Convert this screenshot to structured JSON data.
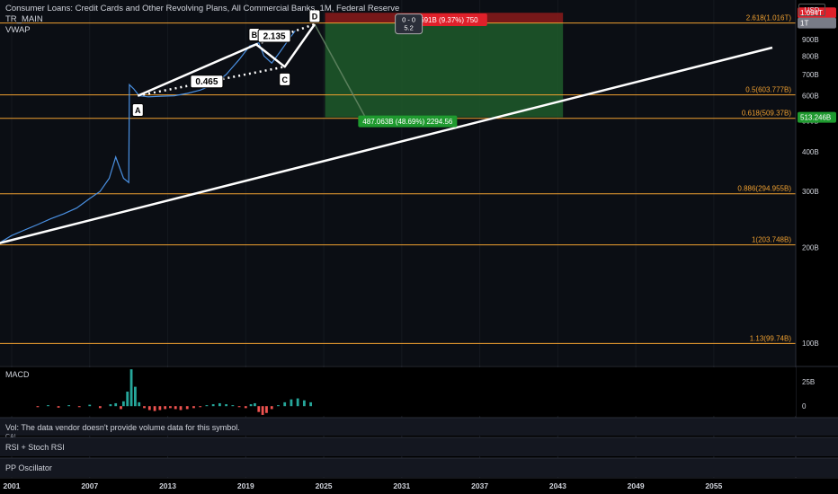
{
  "header": {
    "title": "Consumer Loans: Credit Cards and Other Revolving Plans, All Commercial Banks, 1M, Federal Reserve",
    "indicators": [
      "TR_MAIN",
      "VWAP"
    ]
  },
  "currency_button": "USD",
  "colors": {
    "background": "#000000",
    "price_line": "#4a90e2",
    "fib_line": "#f0a030",
    "pattern_line": "#ffffff",
    "stop_zone": "#8b1a1a",
    "target_zone": "#1e5a2a",
    "badge_red": "#e0202a",
    "badge_green": "#1f9a2f",
    "macd_pos": "#26a69a",
    "macd_neg": "#ef5350"
  },
  "chart_data": {
    "type": "line",
    "title": "Consumer Loans: Credit Cards and Other Revolving Plans, All Commercial Banks, 1M, Federal Reserve",
    "x_ticks": [
      "2001",
      "2007",
      "2013",
      "2019",
      "2025",
      "2031",
      "2037",
      "2043",
      "2049",
      "2055"
    ],
    "x_range": [
      2000.1,
      2061.3
    ],
    "y_scale": "log",
    "y_range_billions": [
      85,
      1200
    ],
    "y_ticks": [
      "1T",
      "900B",
      "800B",
      "700B",
      "600B",
      "500B",
      "400B",
      "300B",
      "200B",
      "100B"
    ],
    "y_tick_values": [
      1000,
      900,
      800,
      700,
      600,
      500,
      400,
      300,
      200,
      100
    ],
    "series": [
      {
        "name": "",
        "x": [
          2000.0,
          2001.0,
          2002.0,
          2003.0,
          2004.0,
          2005.0,
          2006.0,
          2007.0,
          2007.8,
          2008.5,
          2009.0,
          2009.6,
          2010.0,
          2010.05,
          2010.4,
          2010.8,
          2011.5,
          2012.5,
          2013.5,
          2014.5,
          2015.5,
          2016.5,
          2017.5,
          2018.5,
          2019.3,
          2020.0,
          2020.4,
          2021.0,
          2021.6,
          2022.3,
          2022.8
        ],
        "y": [
          206,
          218,
          227,
          236,
          246,
          255,
          266,
          285,
          300,
          330,
          385,
          330,
          320,
          650,
          630,
          600,
          595,
          598,
          600,
          610,
          625,
          650,
          700,
          780,
          860,
          880,
          800,
          760,
          820,
          900,
          960
        ]
      }
    ],
    "fib_levels": [
      {
        "label": "2.618(1.016T)",
        "value": 1016
      },
      {
        "label": "0.5(603.777B)",
        "value": 603.777
      },
      {
        "label": "0.618(509.37B)",
        "value": 509.37
      },
      {
        "label": "0.886(294.955B)",
        "value": 294.955
      },
      {
        "label": "1(203.748B)",
        "value": 203.748
      },
      {
        "label": "1.13(99.74B)",
        "value": 99.74
      }
    ],
    "harmonic_pattern": {
      "points": [
        {
          "label": "A",
          "x": 2010.7,
          "y": 600
        },
        {
          "label": "B",
          "x": 2019.8,
          "y": 870
        },
        {
          "label": "C",
          "x": 2022.0,
          "y": 740
        },
        {
          "label": "D",
          "x": 2024.3,
          "y": 1007
        }
      ],
      "ratios": [
        {
          "label": "0.465",
          "x": 2016.0,
          "y": 665
        },
        {
          "label": "2.135",
          "x": 2021.2,
          "y": 925
        }
      ]
    },
    "trendline": {
      "x": [
        2000.0,
        2059.5
      ],
      "y": [
        206,
        850
      ]
    },
    "projection": {
      "x": [
        2024.3,
        2028.2
      ],
      "y": [
        1007,
        513.246
      ]
    },
    "position": {
      "x_start": 2025.1,
      "x_end": 2043.4,
      "entry": 1016,
      "stop": 1094,
      "target": 513.246,
      "stop_label": "93.691B (9.37%) 750",
      "target_label": "487.063B (48.69%) 2294.56",
      "info_label_top": "0 - 0",
      "info_label_bottom": "5.2"
    },
    "price_labels": [
      {
        "text": "1.094T",
        "value": 1094,
        "kind": "red"
      },
      {
        "text": "1T",
        "value": 1016,
        "kind": "grey"
      },
      {
        "text": "513.246B",
        "value": 513.246,
        "kind": "green"
      }
    ]
  },
  "macd": {
    "label": "MACD",
    "y_ticks": [
      "25B",
      "0"
    ],
    "y_tick_values": [
      25,
      0
    ],
    "y_range": [
      -10,
      40
    ],
    "x": [
      2003.0,
      2003.8,
      2004.6,
      2005.4,
      2006.2,
      2007.0,
      2007.8,
      2008.6,
      2009.0,
      2009.4,
      2009.6,
      2009.9,
      2010.2,
      2010.5,
      2010.8,
      2011.2,
      2011.6,
      2012.0,
      2012.4,
      2012.8,
      2013.2,
      2013.6,
      2014.0,
      2014.5,
      2015.0,
      2015.5,
      2016.0,
      2016.5,
      2017.0,
      2017.5,
      2018.0,
      2018.5,
      2019.0,
      2019.4,
      2019.7,
      2020.0,
      2020.3,
      2020.6,
      2021.0,
      2021.5,
      2022.0,
      2022.5,
      2023.0,
      2023.5,
      2024.0
    ],
    "values": [
      -1,
      1,
      -1.5,
      1,
      -1,
      1.5,
      -2,
      2,
      3,
      -3,
      5,
      15,
      38,
      20,
      4,
      -2,
      -4,
      -5,
      -4,
      -3,
      -2,
      -3,
      -4,
      -3,
      -2,
      -1,
      1,
      2,
      3,
      2,
      1,
      -1,
      -2,
      2,
      3,
      -6,
      -9,
      -7,
      -3,
      1,
      4,
      7,
      8,
      6,
      4
    ]
  },
  "panes": [
    {
      "label": "Vol: The data vendor doesn't provide volume data for this symbol.",
      "sublabel": "CAI"
    },
    {
      "label": "RSI + Stoch RSI"
    },
    {
      "label": "PP Oscillator"
    }
  ]
}
